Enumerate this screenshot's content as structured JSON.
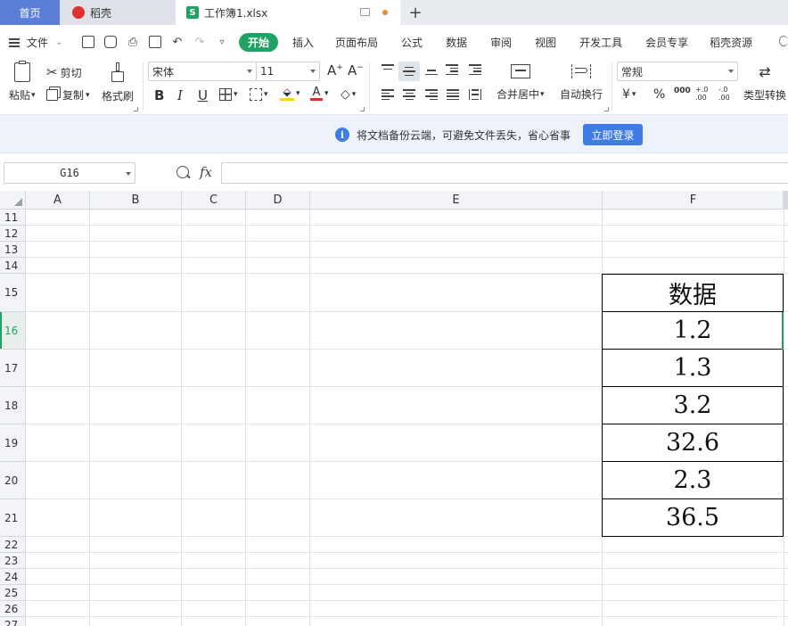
{
  "tabs": {
    "home": "首页",
    "daoke": "稻壳",
    "doc": "工作簿1.xlsx",
    "add": "+"
  },
  "menu": {
    "file": "文件",
    "tabs": [
      "开始",
      "插入",
      "页面布局",
      "公式",
      "数据",
      "审阅",
      "视图",
      "开发工具",
      "会员专享",
      "稻壳资源"
    ]
  },
  "ribbon": {
    "paste": "粘贴",
    "cut": "剪切",
    "copy": "复制",
    "format_painter": "格式刷",
    "font": "宋体",
    "font_size": "11",
    "merge": "合并居中",
    "wrap": "自动换行",
    "number_format": "常规",
    "type_convert": "类型转换",
    "currency": "¥",
    "percent": "%",
    "thousands": "000",
    "inc_decimal": "+.0 .00",
    "dec_decimal": "-.0 .00"
  },
  "notice": {
    "text": "将文档备份云端，可避免文件丢失，省心省事",
    "button": "立即登录"
  },
  "formula_bar": {
    "name_box": "G16",
    "fx": "fx",
    "value": ""
  },
  "grid": {
    "columns": [
      "A",
      "B",
      "C",
      "D",
      "E",
      "F"
    ],
    "rows": [
      "11",
      "12",
      "13",
      "14",
      "15",
      "16",
      "17",
      "18",
      "19",
      "20",
      "21",
      "22",
      "23",
      "24",
      "25",
      "26",
      "27"
    ],
    "active_row": "16",
    "column_f_values": [
      "数据",
      "1.2",
      "1.3",
      "3.2",
      "32.6",
      "2.3",
      "36.5"
    ]
  },
  "colors": {
    "accent_green": "#1fa365",
    "home_tab": "#5b7fd6",
    "login_button": "#3f7ce8"
  }
}
